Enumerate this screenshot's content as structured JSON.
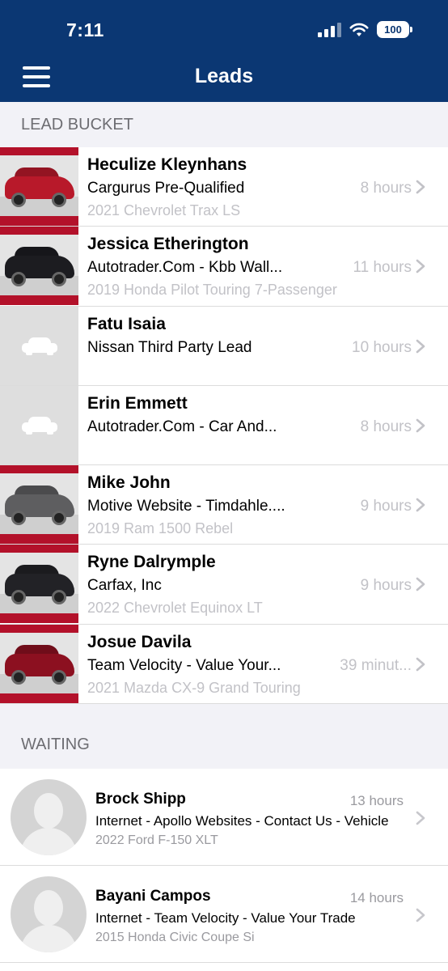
{
  "status_bar": {
    "time": "7:11",
    "battery": "100"
  },
  "nav": {
    "title": "Leads",
    "menu_icon": "hamburger-menu-icon"
  },
  "sections": {
    "lead_bucket": "LEAD BUCKET",
    "waiting": "WAITING"
  },
  "colors": {
    "header": "#0b3773",
    "section_bg": "#f2f2f7",
    "muted_text": "#c2c2c7"
  },
  "leads": [
    {
      "name": "Heculize Kleynhans",
      "source": "Cargurus Pre-Qualified",
      "time": "8 hours",
      "vehicle": "2021 Chevrolet Trax LS",
      "thumb": "photo",
      "car_color": "#b8192a"
    },
    {
      "name": "Jessica Etherington",
      "source": "Autotrader.Com - Kbb Wall...",
      "time": "11 hours",
      "vehicle": "2019 Honda Pilot Touring 7-Passenger",
      "thumb": "photo",
      "car_color": "#1c1c20"
    },
    {
      "name": "Fatu Isaia",
      "source": "Nissan Third Party Lead",
      "time": "10 hours",
      "vehicle": "",
      "thumb": "car-placeholder-icon",
      "car_color": ""
    },
    {
      "name": "Erin Emmett",
      "source": "Autotrader.Com - Car And...",
      "time": "8 hours",
      "vehicle": "",
      "thumb": "car-placeholder-icon",
      "car_color": ""
    },
    {
      "name": "Mike John",
      "source": "Motive Website - Timdahle....",
      "time": "9 hours",
      "vehicle": "2019 Ram 1500 Rebel",
      "thumb": "photo",
      "car_color": "#5e5e60"
    },
    {
      "name": "Ryne Dalrymple",
      "source": "Carfax, Inc",
      "time": "9 hours",
      "vehicle": "2022 Chevrolet Equinox LT",
      "thumb": "photo",
      "car_color": "#222226"
    },
    {
      "name": "Josue Davila",
      "source": "Team Velocity - Value Your...",
      "time": "39 minut...",
      "vehicle": "2021 Mazda CX-9 Grand Touring",
      "thumb": "photo",
      "car_color": "#8c1020"
    }
  ],
  "waiting": [
    {
      "name": "Brock Shipp",
      "source": "Internet - Apollo Websites - Contact Us - Vehicle",
      "time": "13 hours",
      "vehicle": "2022 Ford F-150 XLT",
      "avatar": "person-placeholder-icon"
    },
    {
      "name": "Bayani Campos",
      "source": "Internet - Team Velocity - Value Your Trade",
      "time": "14 hours",
      "vehicle": "2015 Honda Civic Coupe Si",
      "avatar": "person-placeholder-icon"
    }
  ]
}
